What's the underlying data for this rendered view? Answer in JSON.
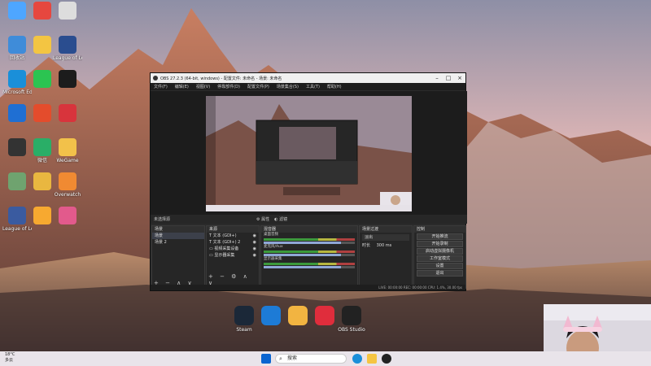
{
  "desktop": {
    "icons": [
      {
        "label": "",
        "name": "this-pc-icon"
      },
      {
        "label": "",
        "name": "chrome-icon"
      },
      {
        "label": "",
        "name": "file-icon"
      },
      {
        "label": "回收站",
        "name": "recycle-bin-icon"
      },
      {
        "label": "",
        "name": "folder-icon"
      },
      {
        "label": "League of Legends",
        "name": "league-icon"
      },
      {
        "label": "Microsoft Edge",
        "name": "edge-icon"
      },
      {
        "label": "",
        "name": "app-green-icon"
      },
      {
        "label": "",
        "name": "app-yellow-icon"
      },
      {
        "label": "",
        "name": "app-blue-icon"
      },
      {
        "label": "",
        "name": "app-red-icon"
      },
      {
        "label": "",
        "name": "app-red2-icon"
      },
      {
        "label": "",
        "name": "app-black-icon"
      },
      {
        "label": "微信",
        "name": "wechat-icon"
      },
      {
        "label": "WeGame",
        "name": "wegame-icon"
      },
      {
        "label": "",
        "name": "app-flower-icon"
      },
      {
        "label": "",
        "name": "folder2-icon"
      },
      {
        "label": "Overwatch",
        "name": "overwatch-icon"
      },
      {
        "label": "League of Legends",
        "name": "league2-icon"
      },
      {
        "label": "",
        "name": "app-orange-icon"
      },
      {
        "label": "",
        "name": "app-pink-icon"
      }
    ],
    "dock": [
      {
        "label": "Steam",
        "name": "steam-icon"
      },
      {
        "label": "",
        "name": "app-cyan-icon"
      },
      {
        "label": "",
        "name": "yy-icon"
      },
      {
        "label": "",
        "name": "netease-music-icon"
      },
      {
        "label": "OBS Studio",
        "name": "obs-studio-icon"
      }
    ]
  },
  "obs": {
    "title": "OBS 27.2.3 (64-bit, windows) - 配置文件: 未命名 - 场景: 未命名",
    "menu": [
      "文件(F)",
      "编辑(E)",
      "视图(V)",
      "停靠部件(D)",
      "配置文件(P)",
      "场景集合(S)",
      "工具(T)",
      "帮助(H)"
    ],
    "preview_bar": {
      "filter_label": "滤镜",
      "props_label": "属性",
      "source_label": "未选择源"
    },
    "scenes": {
      "title": "场景",
      "items": [
        "场景",
        "场景 2"
      ]
    },
    "sources": {
      "title": "来源",
      "items": [
        "文本 (GDI+)",
        "文本 (GDI+) 2",
        "视频采集设备",
        "显示器采集"
      ]
    },
    "mixer": {
      "title": "混音器",
      "channels": [
        "桌面音频",
        "麦克风/Aux",
        "显示器采集"
      ]
    },
    "transitions": {
      "title": "场景过渡",
      "type": "淡出",
      "duration_label": "时长",
      "duration": "300 ms"
    },
    "controls": {
      "title": "控制",
      "buttons": [
        "开始推流",
        "开始录制",
        "启动虚拟摄像机",
        "工作室模式",
        "设置",
        "退出"
      ]
    },
    "status": "LIVE: 00:00:00   REC: 00:00:00   CPU: 1.4%, 30.00 fps"
  },
  "taskbar": {
    "weather_temp": "18°C",
    "weather_desc": "多云",
    "search_placeholder": "搜索"
  },
  "colors": {
    "obs_bg": "#2b2b2b",
    "taskbar_bg": "#e9e4ea",
    "accent": "#0078d4"
  }
}
